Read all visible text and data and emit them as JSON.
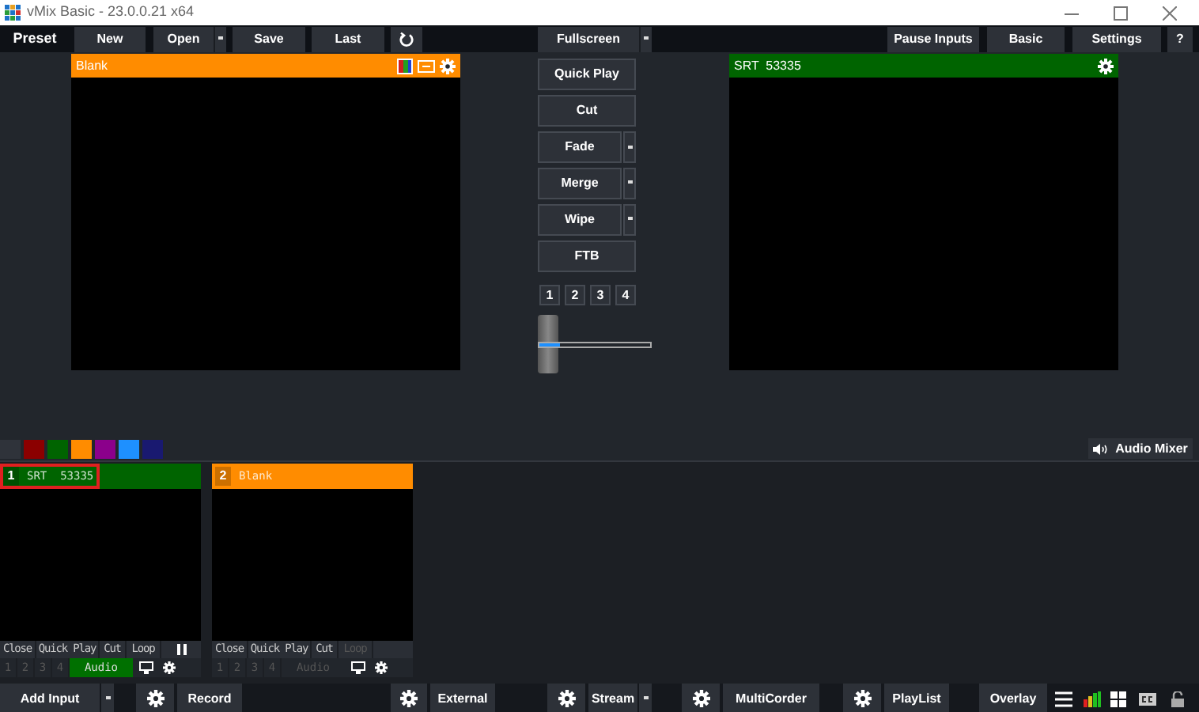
{
  "window": {
    "title": "vMix Basic - 23.0.0.21 x64"
  },
  "toolbar": {
    "label": "Preset",
    "buttons": [
      {
        "label": "New",
        "kind": "button"
      },
      {
        "label": "Open",
        "kind": "dropdown"
      },
      {
        "label": "Save",
        "kind": "button"
      },
      {
        "label": "Last",
        "kind": "button"
      },
      {
        "kind": "refresh"
      },
      {
        "label": "Fullscreen",
        "kind": "dropdown"
      },
      {
        "label": "Pause Inputs",
        "kind": "button"
      },
      {
        "label": "Basic",
        "kind": "button"
      },
      {
        "label": "Settings",
        "kind": "button"
      },
      {
        "label": "?",
        "kind": "button"
      }
    ]
  },
  "preview": {
    "title": "Blank",
    "color": "#ff8c00"
  },
  "output": {
    "title": "SRT  53335",
    "color": "#006400"
  },
  "transitions": [
    {
      "label": "Quick Play",
      "kind": "button"
    },
    {
      "label": "Cut",
      "kind": "button"
    },
    {
      "label": "Fade",
      "kind": "dropdown"
    },
    {
      "label": "Merge",
      "kind": "dropdown"
    },
    {
      "label": "Wipe",
      "kind": "dropdown"
    },
    {
      "label": "FTB",
      "kind": "button"
    }
  ],
  "transition_numbers": [
    "1",
    "2",
    "3",
    "4"
  ],
  "tbar": {
    "level": 0.18
  },
  "color_tags": [
    {
      "color": "#2f333a"
    },
    {
      "color": "#8b0000"
    },
    {
      "color": "#006400"
    },
    {
      "color": "#ff8c00"
    },
    {
      "color": "#8b008b"
    },
    {
      "color": "#1e90ff"
    },
    {
      "color": "#191970"
    }
  ],
  "audio_mixer": {
    "label": "Audio Mixer"
  },
  "inputs": [
    {
      "number": "1",
      "title": "SRT  53335",
      "color": "#006400",
      "selected": true,
      "controls": [
        {
          "label": "Close",
          "disabled": false
        },
        {
          "label": "Quick Play",
          "disabled": false
        },
        {
          "label": "Cut",
          "disabled": false
        },
        {
          "label": "Loop",
          "disabled": false
        }
      ],
      "playing": true,
      "buses": [
        "1",
        "2",
        "3",
        "4"
      ],
      "audio": {
        "label": "Audio",
        "on": true
      }
    },
    {
      "number": "2",
      "title": "Blank",
      "color": "#ff8c00",
      "selected": false,
      "controls": [
        {
          "label": "Close",
          "disabled": false
        },
        {
          "label": "Quick Play",
          "disabled": false
        },
        {
          "label": "Cut",
          "disabled": false
        },
        {
          "label": "Loop",
          "disabled": true
        }
      ],
      "playing": false,
      "buses": [
        "1",
        "2",
        "3",
        "4"
      ],
      "audio": {
        "label": "Audio",
        "on": false
      }
    }
  ],
  "bottom_bar": [
    {
      "label": "Add Input",
      "kind": "dropdown"
    },
    {
      "kind": "gear"
    },
    {
      "label": "Record",
      "kind": "button"
    },
    {
      "kind": "gear"
    },
    {
      "label": "External",
      "kind": "button"
    },
    {
      "kind": "gear"
    },
    {
      "label": "Stream",
      "kind": "dropdown"
    },
    {
      "kind": "gear"
    },
    {
      "label": "MultiCorder",
      "kind": "button"
    },
    {
      "kind": "gear"
    },
    {
      "label": "PlayList",
      "kind": "button"
    },
    {
      "label": "Overlay",
      "kind": "button"
    },
    {
      "kind": "menu"
    },
    {
      "kind": "meters"
    },
    {
      "kind": "grid"
    },
    {
      "kind": "cc"
    },
    {
      "kind": "lock"
    }
  ]
}
